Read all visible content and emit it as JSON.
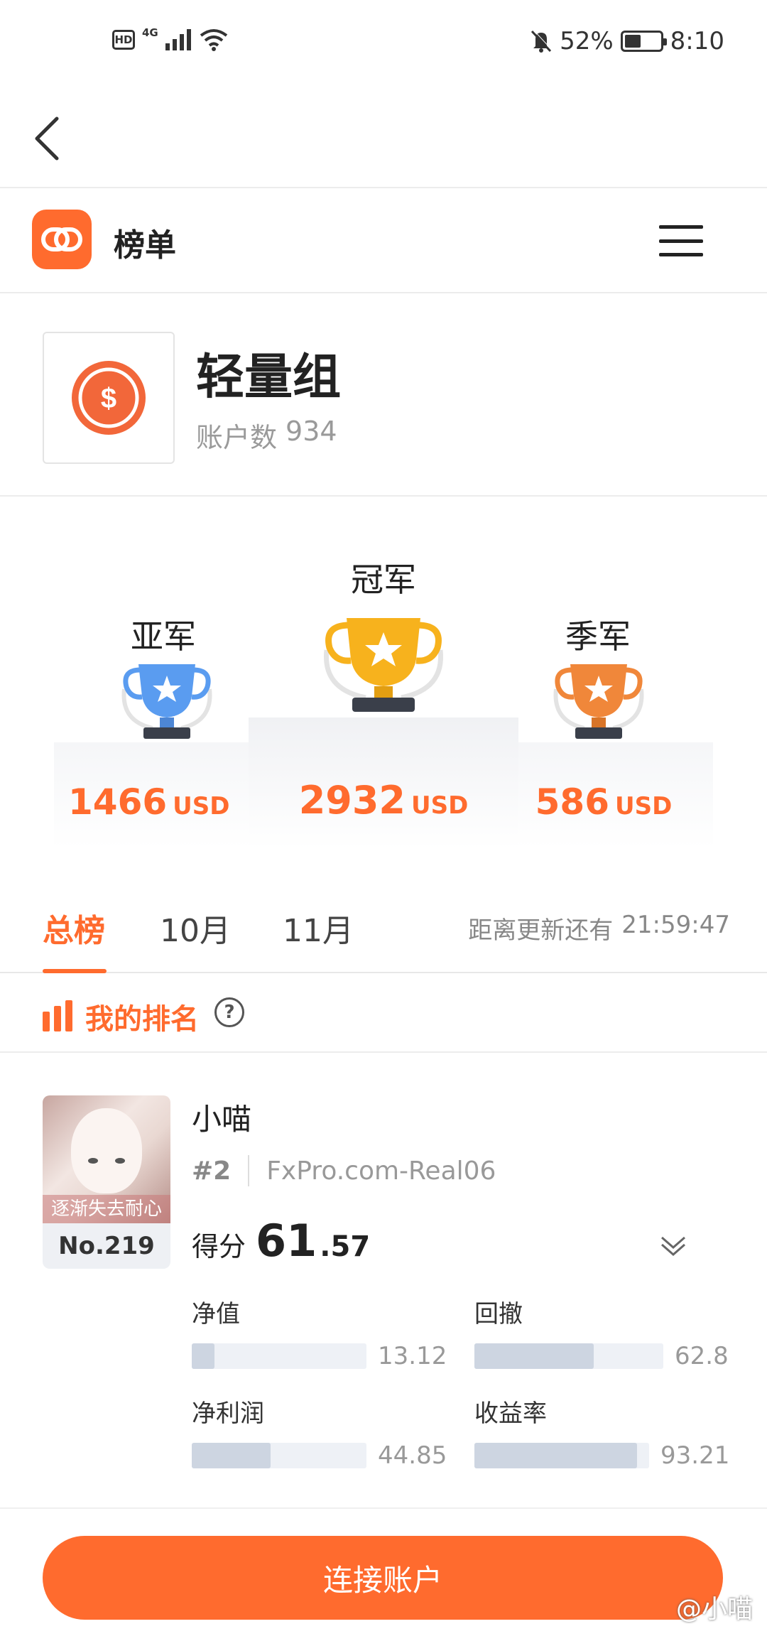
{
  "status_bar": {
    "hd": "HD",
    "network": "4G",
    "battery": "52%",
    "battery_level": 0.52,
    "time": "8:10"
  },
  "header": {
    "title": "榜单"
  },
  "group": {
    "name": "轻量组",
    "account_label": "账户数",
    "account_count": "934",
    "icon_symbol": "$"
  },
  "podium": {
    "second": {
      "label": "亚军",
      "amount": "1466",
      "unit": "USD",
      "trophy_color": "#5a9cf0"
    },
    "first": {
      "label": "冠军",
      "amount": "2932",
      "unit": "USD",
      "trophy_color": "#f7b21d"
    },
    "third": {
      "label": "季军",
      "amount": "586",
      "unit": "USD",
      "trophy_color": "#f0873a"
    }
  },
  "tabs": [
    {
      "label": "总榜",
      "active": true
    },
    {
      "label": "10月",
      "active": false
    },
    {
      "label": "11月",
      "active": false
    }
  ],
  "countdown": {
    "label": "距离更新还有",
    "time": "21:59:47"
  },
  "my_rank": {
    "title": "我的排名",
    "help": "?"
  },
  "user": {
    "name": "小喵",
    "rank": "#2",
    "server": "FxPro.com-Real06",
    "avatar_caption": "逐渐失去耐心",
    "no": "No.219",
    "score_label": "得分",
    "score_int": "61",
    "score_dec": ".57",
    "metrics": [
      {
        "label": "净值",
        "value": "13.12",
        "fill": 0.13
      },
      {
        "label": "回撤",
        "value": "62.8",
        "fill": 0.63
      },
      {
        "label": "净利润",
        "value": "44.85",
        "fill": 0.45
      },
      {
        "label": "收益率",
        "value": "93.21",
        "fill": 0.93
      }
    ]
  },
  "actions": {
    "connect": "连接账户"
  },
  "watermark": "@小喵",
  "colors": {
    "accent": "#ff6b2e",
    "bar_fill": "#cdd5e1",
    "bar_track": "#eef1f6"
  }
}
